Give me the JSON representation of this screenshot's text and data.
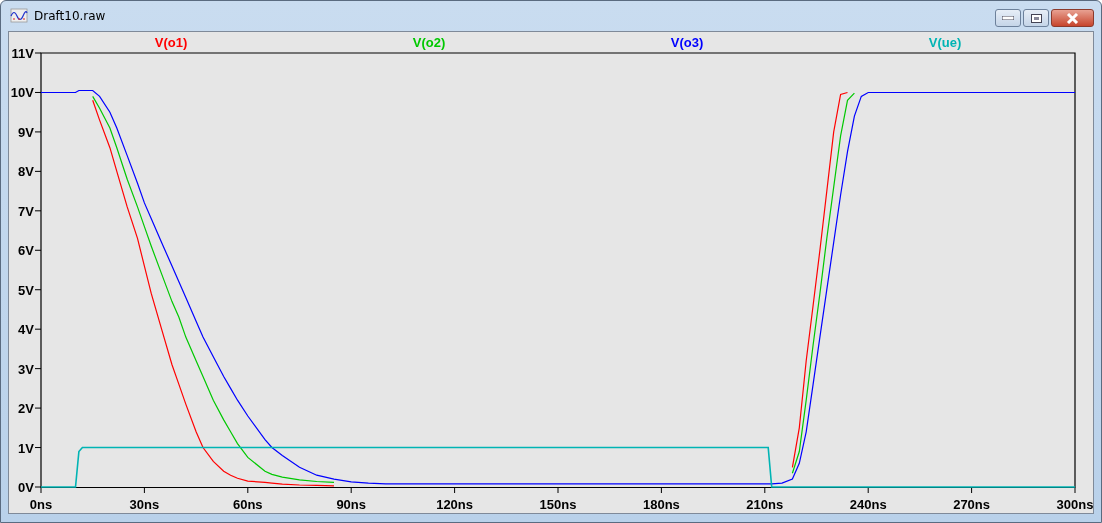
{
  "window": {
    "title": "Draft10.raw"
  },
  "plot": {
    "chart_data": {
      "type": "line",
      "x": [
        0,
        10,
        11,
        12,
        15,
        17,
        20,
        22,
        25,
        28,
        30,
        32,
        35,
        38,
        40,
        42,
        45,
        47,
        50,
        53,
        55,
        57,
        60,
        65,
        67,
        70,
        75,
        80,
        85,
        90,
        95,
        100,
        150,
        210,
        211,
        212,
        215,
        218,
        220,
        222,
        224,
        226,
        228,
        230,
        232,
        234,
        236,
        238,
        240,
        242,
        250,
        300
      ],
      "series": [
        {
          "name": "V(o1)",
          "color": "#ff0000",
          "values": [
            null,
            null,
            null,
            null,
            9.8,
            9.3,
            8.6,
            8,
            7.1,
            6.3,
            5.6,
            4.9,
            4,
            3.1,
            2.6,
            2.1,
            1.4,
            1,
            0.65,
            0.4,
            0.3,
            0.22,
            0.15,
            0.12,
            0.1,
            0.07,
            0.05,
            0.04,
            0.03,
            null,
            null,
            null,
            null,
            null,
            null,
            null,
            null,
            0.5,
            1.5,
            3.2,
            4.6,
            6,
            7.5,
            9,
            9.95,
            10,
            null,
            null,
            null,
            null,
            null,
            null
          ]
        },
        {
          "name": "V(o2)",
          "color": "#00c800",
          "values": [
            null,
            null,
            null,
            null,
            9.9,
            9.6,
            9.1,
            8.6,
            7.8,
            7.1,
            6.6,
            6.1,
            5.4,
            4.7,
            4.3,
            3.8,
            3.2,
            2.8,
            2.2,
            1.7,
            1.4,
            1.1,
            0.75,
            0.4,
            0.32,
            0.25,
            0.18,
            0.14,
            0.12,
            null,
            null,
            null,
            null,
            null,
            null,
            null,
            null,
            0.35,
            0.9,
            2.2,
            3.6,
            4.9,
            6.3,
            7.6,
            8.9,
            9.8,
            9.98,
            null,
            null,
            null,
            null,
            null
          ]
        },
        {
          "name": "V(o3)",
          "color": "#0000ff",
          "values": [
            10,
            10,
            10.05,
            10.05,
            10.05,
            9.9,
            9.5,
            9.1,
            8.4,
            7.7,
            7.2,
            6.8,
            6.2,
            5.6,
            5.2,
            4.8,
            4.2,
            3.8,
            3.3,
            2.8,
            2.5,
            2.2,
            1.8,
            1.2,
            1.0,
            0.8,
            0.5,
            0.3,
            0.2,
            0.13,
            0.1,
            0.08,
            0.08,
            0.08,
            0.08,
            0.08,
            0.1,
            0.2,
            0.6,
            1.4,
            2.6,
            3.8,
            5,
            6.2,
            7.4,
            8.5,
            9.4,
            9.9,
            10,
            10,
            10,
            10
          ]
        },
        {
          "name": "V(ue)",
          "color": "#00b4b4",
          "values": [
            0,
            0,
            0.9,
            1,
            1,
            1,
            1,
            1,
            1,
            1,
            1,
            1,
            1,
            1,
            1,
            1,
            1,
            1,
            1,
            1,
            1,
            1,
            1,
            1,
            1,
            1,
            1,
            1,
            1,
            1,
            1,
            1,
            1,
            1,
            1,
            0,
            0,
            0,
            0,
            0,
            0,
            0,
            0,
            0,
            0,
            0,
            0,
            0,
            0,
            0,
            0,
            0
          ]
        }
      ],
      "xlim": [
        0,
        300
      ],
      "ylim": [
        0,
        11
      ],
      "xticks": [
        {
          "value": 0,
          "label": "0ns"
        },
        {
          "value": 30,
          "label": "30ns"
        },
        {
          "value": 60,
          "label": "60ns"
        },
        {
          "value": 90,
          "label": "90ns"
        },
        {
          "value": 120,
          "label": "120ns"
        },
        {
          "value": 150,
          "label": "150ns"
        },
        {
          "value": 180,
          "label": "180ns"
        },
        {
          "value": 210,
          "label": "210ns"
        },
        {
          "value": 240,
          "label": "240ns"
        },
        {
          "value": 270,
          "label": "270ns"
        },
        {
          "value": 300,
          "label": "300ns"
        }
      ],
      "yticks": [
        {
          "value": 0,
          "label": "0V"
        },
        {
          "value": 1,
          "label": "1V"
        },
        {
          "value": 2,
          "label": "2V"
        },
        {
          "value": 3,
          "label": "3V"
        },
        {
          "value": 4,
          "label": "4V"
        },
        {
          "value": 5,
          "label": "5V"
        },
        {
          "value": 6,
          "label": "6V"
        },
        {
          "value": 7,
          "label": "7V"
        },
        {
          "value": 8,
          "label": "8V"
        },
        {
          "value": 9,
          "label": "9V"
        },
        {
          "value": 10,
          "label": "10V"
        },
        {
          "value": 11,
          "label": "11V"
        }
      ]
    }
  }
}
